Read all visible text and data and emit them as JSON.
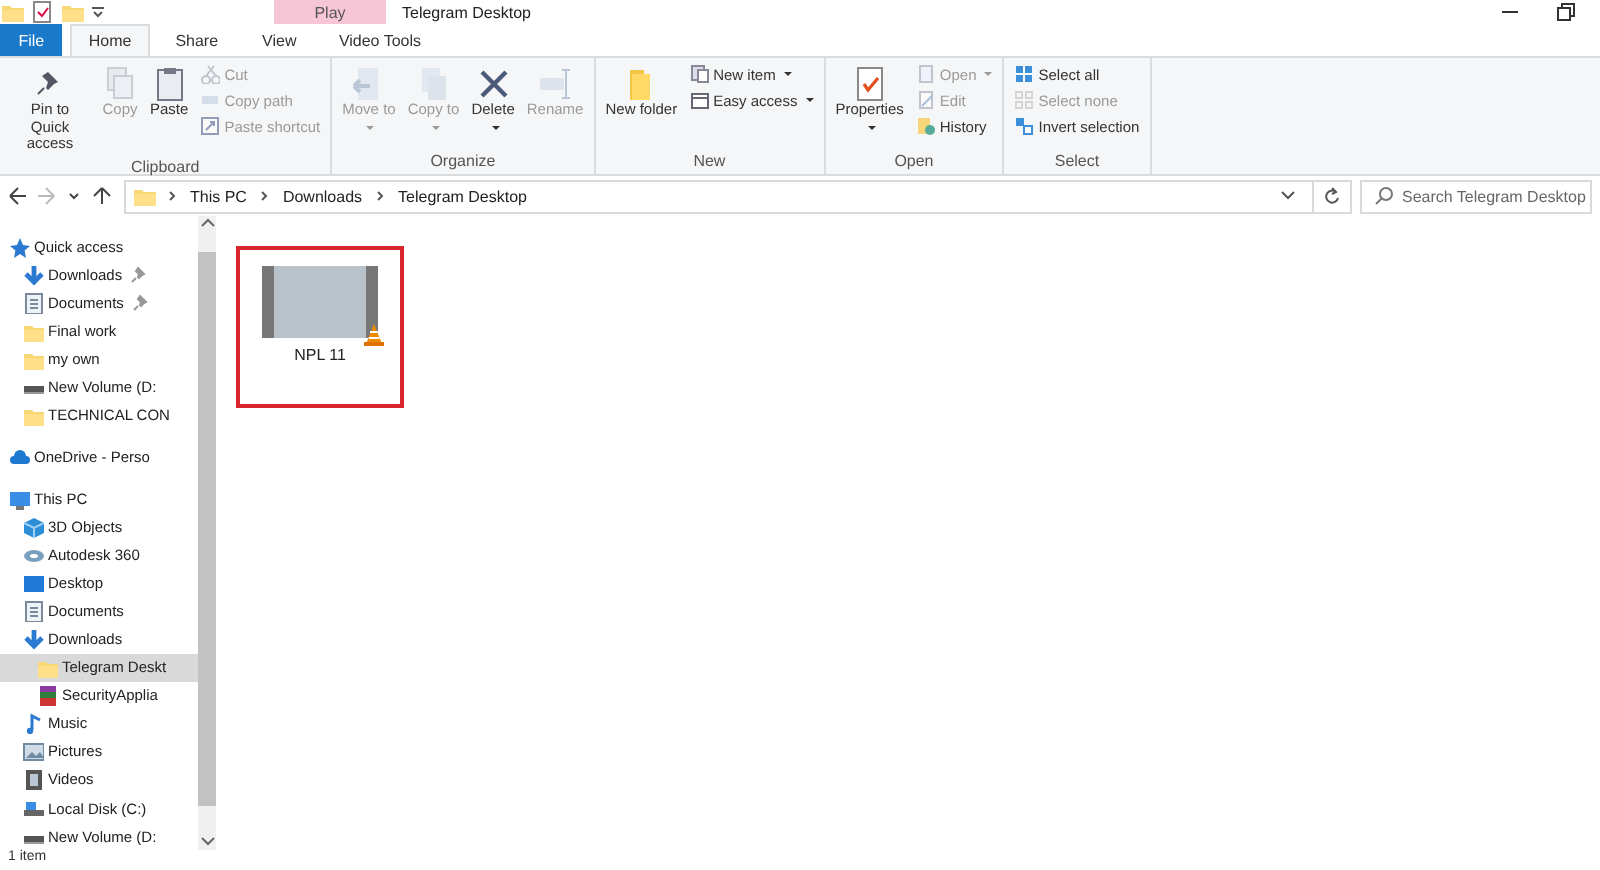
{
  "title_bar": {
    "context_header": "Play",
    "title": "Telegram Desktop"
  },
  "tabs": [
    {
      "label": "File",
      "kind": "file",
      "selected": false
    },
    {
      "label": "Home",
      "kind": "plain",
      "selected": true
    },
    {
      "label": "Share",
      "kind": "plain",
      "selected": false
    },
    {
      "label": "View",
      "kind": "plain",
      "selected": false
    },
    {
      "label": "Video Tools",
      "kind": "context",
      "selected": false
    }
  ],
  "ribbon": {
    "groups": [
      {
        "label": "Clipboard",
        "items": [
          {
            "label": "Pin to Quick access",
            "kind": "large",
            "disabled": false
          },
          {
            "label": "Copy",
            "kind": "large",
            "disabled": true
          },
          {
            "label": "Paste",
            "kind": "large",
            "disabled": false
          },
          {
            "label": "Cut",
            "kind": "small",
            "disabled": true
          },
          {
            "label": "Copy path",
            "kind": "small",
            "disabled": true
          },
          {
            "label": "Paste shortcut",
            "kind": "small",
            "disabled": true
          }
        ]
      },
      {
        "label": "Organize",
        "items": [
          {
            "label": "Move to",
            "kind": "large",
            "disabled": true,
            "dropdown": true
          },
          {
            "label": "Copy to",
            "kind": "large",
            "disabled": true,
            "dropdown": true
          },
          {
            "label": "Delete",
            "kind": "large",
            "disabled": false,
            "dropdown": true
          },
          {
            "label": "Rename",
            "kind": "large",
            "disabled": true
          }
        ]
      },
      {
        "label": "New",
        "items": [
          {
            "label": "New folder",
            "kind": "large",
            "disabled": false
          },
          {
            "label": "New item",
            "kind": "small",
            "disabled": false,
            "dropdown": true
          },
          {
            "label": "Easy access",
            "kind": "small",
            "disabled": false,
            "dropdown": true
          }
        ]
      },
      {
        "label": "Open",
        "items": [
          {
            "label": "Properties",
            "kind": "large",
            "disabled": false,
            "dropdown": true
          },
          {
            "label": "Open",
            "kind": "small",
            "disabled": true,
            "dropdown": true
          },
          {
            "label": "Edit",
            "kind": "small",
            "disabled": true
          },
          {
            "label": "History",
            "kind": "small",
            "disabled": false
          }
        ]
      },
      {
        "label": "Select",
        "items": [
          {
            "label": "Select all",
            "kind": "small",
            "disabled": false
          },
          {
            "label": "Select none",
            "kind": "small",
            "disabled": true
          },
          {
            "label": "Invert selection",
            "kind": "small",
            "disabled": false
          }
        ]
      }
    ]
  },
  "address_bar": {
    "forward_disabled": true,
    "path": [
      "This PC",
      "Downloads",
      "Telegram Desktop"
    ],
    "search": {
      "placeholder": "Search Telegram Desktop"
    }
  },
  "navigation_pane": {
    "items": [
      {
        "label": "Quick access",
        "kind": "star",
        "selected": false,
        "children": [
          {
            "label": "Downloads",
            "kind": "download",
            "selected": false,
            "pinned": true
          },
          {
            "label": "Documents",
            "kind": "document",
            "selected": false,
            "pinned": true
          },
          {
            "label": "Final work",
            "kind": "folder",
            "selected": false,
            "pinned": false
          },
          {
            "label": "my own",
            "kind": "folder",
            "selected": false,
            "pinned": false
          },
          {
            "label": "New Volume (D:",
            "kind": "drive",
            "selected": false,
            "pinned": false
          },
          {
            "label": "TECHNICAL CON",
            "kind": "folder",
            "selected": false,
            "pinned": false
          }
        ]
      },
      {
        "label": "OneDrive - Perso",
        "kind": "cloud",
        "selected": false
      },
      {
        "label": "This PC",
        "kind": "computer",
        "selected": false,
        "children": [
          {
            "label": "3D Objects",
            "kind": "cube",
            "selected": false
          },
          {
            "label": "Autodesk 360",
            "kind": "disc",
            "selected": false
          },
          {
            "label": "Desktop",
            "kind": "monitor",
            "selected": false
          },
          {
            "label": "Documents",
            "kind": "document",
            "selected": false
          },
          {
            "label": "Downloads",
            "kind": "download",
            "selected": false,
            "children": [
              {
                "label": "Telegram Deskt",
                "kind": "folder",
                "selected": true
              },
              {
                "label": "SecurityApplia",
                "kind": "archive",
                "selected": false
              }
            ]
          },
          {
            "label": "Music",
            "kind": "music",
            "selected": false
          },
          {
            "label": "Pictures",
            "kind": "picture",
            "selected": false
          },
          {
            "label": "Videos",
            "kind": "film",
            "selected": false
          },
          {
            "label": "Local Disk (C:)",
            "kind": "disk",
            "selected": false
          },
          {
            "label": "New Volume (D:",
            "kind": "drive",
            "selected": false
          }
        ]
      }
    ]
  },
  "files": [
    {
      "name": "NPL 11",
      "highlighted": true
    }
  ],
  "status_bar": {
    "text": "1 item"
  }
}
